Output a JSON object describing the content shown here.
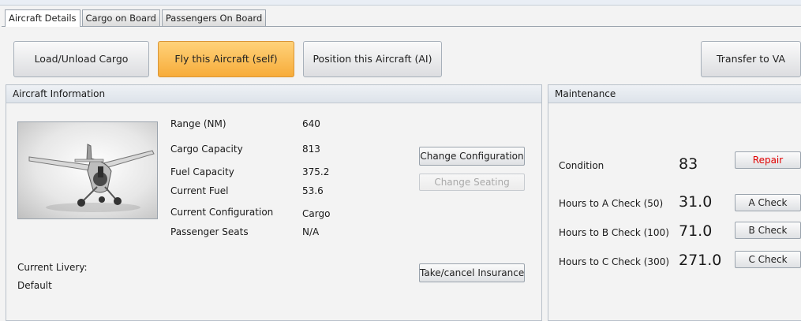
{
  "tabs": [
    "Aircraft Details",
    "Cargo on Board",
    "Passengers On Board"
  ],
  "actions": {
    "load_cargo": "Load/Unload Cargo",
    "fly_self": "Fly this Aircraft (self)",
    "position_ai": "Position this Aircraft (AI)",
    "transfer_va": "Transfer to VA"
  },
  "aircraft_info": {
    "title": "Aircraft Information",
    "fields": [
      {
        "label": "Range (NM)",
        "value": "640"
      },
      {
        "label": "Cargo Capacity",
        "value": "813"
      },
      {
        "label": "Fuel Capacity",
        "value": "375.2"
      },
      {
        "label": "Current Fuel",
        "value": "53.6"
      },
      {
        "label": "Current Configuration",
        "value": "Cargo"
      },
      {
        "label": "Passenger Seats",
        "value": "N/A"
      }
    ],
    "change_configuration": "Change Configuration",
    "change_seating": "Change Seating",
    "take_cancel_insurance": "Take/cancel Insurance",
    "livery_label": "Current Livery:",
    "livery_value": "Default"
  },
  "maintenance": {
    "title": "Maintenance",
    "condition_label": "Condition",
    "condition_value": "83",
    "repair": "Repair",
    "checks": [
      {
        "label": "Hours to A Check (50)",
        "value": "31.0",
        "button": "A Check"
      },
      {
        "label": "Hours to B Check (100)",
        "value": "71.0",
        "button": "B Check"
      },
      {
        "label": "Hours to C Check (300)",
        "value": "271.0",
        "button": "C Check"
      }
    ]
  },
  "colors": {
    "accent_orange": "#f7ac3a",
    "repair_red": "#e00000"
  },
  "icons": [
    "aircraft-photo"
  ]
}
